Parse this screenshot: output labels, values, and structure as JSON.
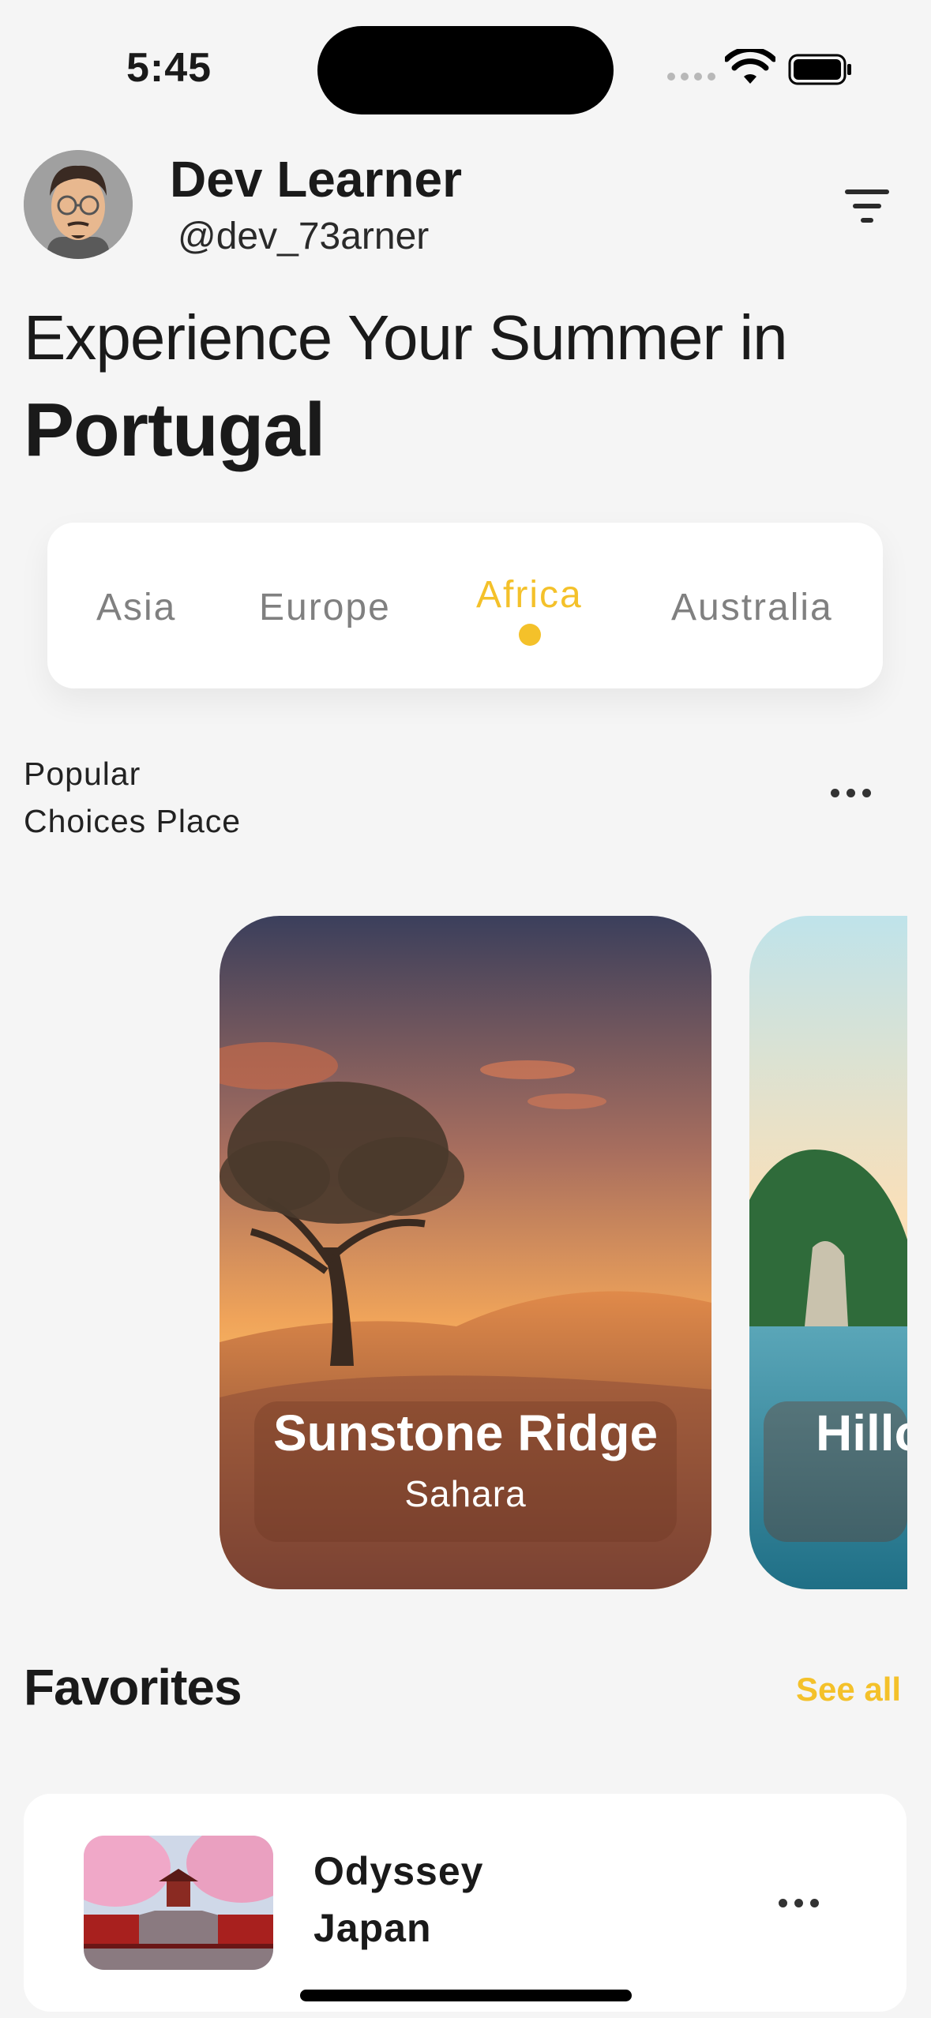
{
  "status_bar": {
    "time": "5:45"
  },
  "profile": {
    "name": "Dev Learner",
    "handle": "@dev_73arner"
  },
  "headline": {
    "line1": "Experience Your Summer in",
    "line2": "Portugal"
  },
  "tabs": [
    {
      "label": "Asia",
      "active": false
    },
    {
      "label": "Europe",
      "active": false
    },
    {
      "label": "Africa",
      "active": true
    },
    {
      "label": "Australia",
      "active": false
    }
  ],
  "section": {
    "line1": "Popular",
    "line2": "Choices Place"
  },
  "destinations": [
    {
      "title": "Sunstone Ridge",
      "subtitle": "Sahara"
    },
    {
      "title": "Hillo",
      "subtitle": ""
    }
  ],
  "favorites": {
    "title": "Favorites",
    "see_all": "See all",
    "items": [
      {
        "name_line1": "Odyssey",
        "name_line2": "Japan"
      }
    ]
  },
  "colors": {
    "accent": "#f4c12a",
    "background": "#f5f5f5"
  },
  "icons": [
    "wifi-icon",
    "battery-icon",
    "filter-icon",
    "more-icon"
  ]
}
